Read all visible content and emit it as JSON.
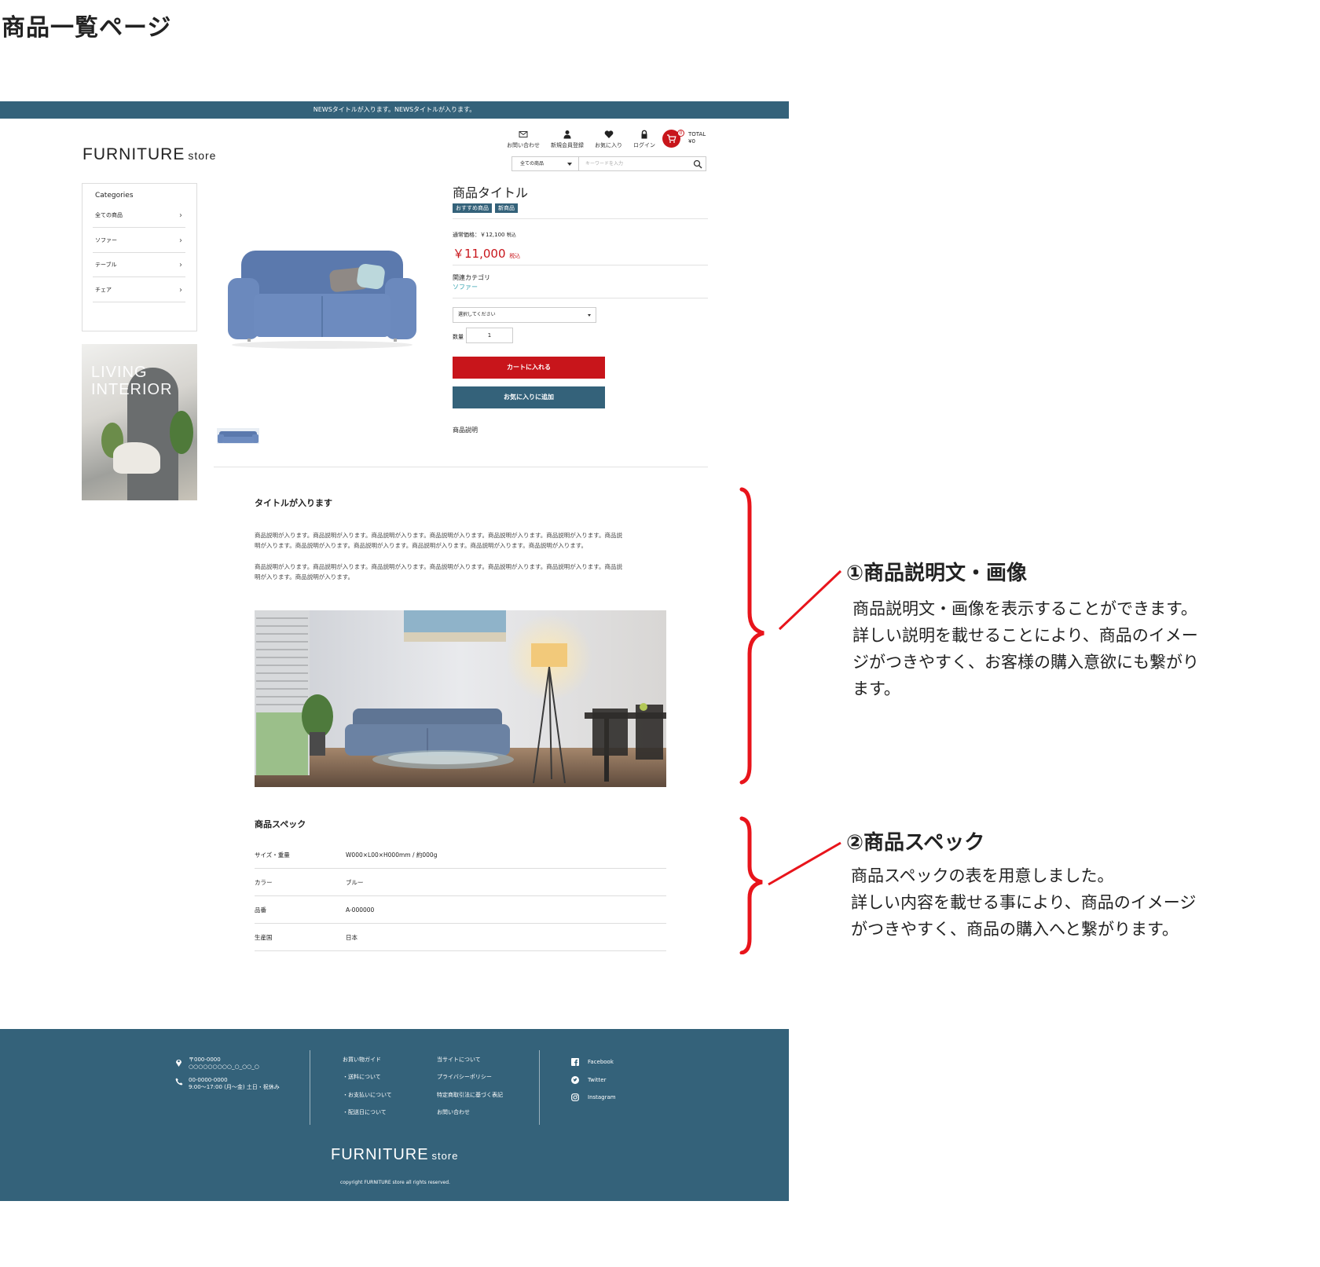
{
  "page_heading": "商品一覧ページ",
  "news": "NEWSタイトルが入ります。NEWSタイトルが入ります。",
  "logo": {
    "main": "FURNITURE",
    "sub": "store"
  },
  "header_nav": [
    {
      "label": "お問い合わせ",
      "icon": "mail-icon"
    },
    {
      "label": "新規会員登録",
      "icon": "user-icon"
    },
    {
      "label": "お気に入り",
      "icon": "heart-icon"
    },
    {
      "label": "ログイン",
      "icon": "lock-icon"
    }
  ],
  "cart": {
    "badge": "0",
    "total_label": "TOTAL",
    "total_value": "¥0"
  },
  "search": {
    "category": "全ての商品",
    "placeholder": "キーワードを入力"
  },
  "categories": {
    "title": "Categories",
    "items": [
      "全ての商品",
      "ソファー",
      "テーブル",
      "チェア"
    ]
  },
  "banner": {
    "line1": "LIVING",
    "line2": "INTERIOR"
  },
  "product": {
    "title": "商品タイトル",
    "tags": [
      "おすすめ商品",
      "新商品"
    ],
    "regular_price": "通常価格：￥12,100",
    "regular_tax": "税込",
    "sale_price": "￥11,000",
    "sale_tax": "税込",
    "related_label": "関連カテゴリ",
    "related_link": "ソファー",
    "option_placeholder": "選択してください",
    "qty_label": "数量",
    "qty_value": "1",
    "cart_button": "カートに入れる",
    "fav_button": "お気に入りに追加",
    "desc_label": "商品説明"
  },
  "description": {
    "title": "タイトルが入ります",
    "para1_line1": "商品説明が入ります。商品説明が入ります。商品説明が入ります。商品説明が入ります。商品説明が入ります。商品説明が入ります。商品説",
    "para1_line2": "明が入ります。商品説明が入ります。商品説明が入ります。商品説明が入ります。商品説明が入ります。商品説明が入ります。",
    "para2_line1": "商品説明が入ります。商品説明が入ります。商品説明が入ります。商品説明が入ります。商品説明が入ります。商品説明が入ります。商品説",
    "para2_line2": "明が入ります。商品説明が入ります。"
  },
  "spec": {
    "title": "商品スペック",
    "rows": [
      {
        "key": "サイズ・重量",
        "value": "W000×L00×H000mm / 約000g"
      },
      {
        "key": "カラー",
        "value": "ブルー"
      },
      {
        "key": "品番",
        "value": "A-000000"
      },
      {
        "key": "生産国",
        "value": "日本"
      }
    ]
  },
  "footer": {
    "postal": "〒000-0000",
    "address": "○○○○○○○○○_○_○○_○",
    "phone": "00-0000-0000",
    "hours": "9:00～17:00 (月～金) 土日・祝休み",
    "links_col1": [
      "お買い物ガイド",
      "・送料について",
      "・お支払いについて",
      "・配送日について"
    ],
    "links_col2": [
      "当サイトについて",
      "プライバシーポリシー",
      "特定商取引法に基づく表記",
      "お問い合わせ"
    ],
    "social": [
      {
        "label": "Facebook",
        "icon": "facebook-icon"
      },
      {
        "label": "Twitter",
        "icon": "twitter-icon"
      },
      {
        "label": "Instagram",
        "icon": "instagram-icon"
      }
    ],
    "logo_main": "FURNITURE",
    "logo_sub": "store",
    "copyright": "copyright FURNITURE store all rights reserved."
  },
  "annotations": [
    {
      "title": "①商品説明文・画像",
      "lines": [
        "商品説明文・画像を表示することができます。",
        "詳しい説明を載せることにより、商品のイメー",
        "ジがつきやすく、お客様の購入意欲にも繋がり",
        "ます。"
      ]
    },
    {
      "title": "②商品スペック",
      "lines": [
        "商品スペックの表を用意しました。",
        "詳しい内容を載せる事により、商品のイメージ",
        "がつきやすく、商品の購入へと繋がります。"
      ]
    }
  ],
  "colors": {
    "brand": "#34627a",
    "accent_red": "#c8151b",
    "link": "#34a3b0",
    "annotation": "#e8141b"
  }
}
